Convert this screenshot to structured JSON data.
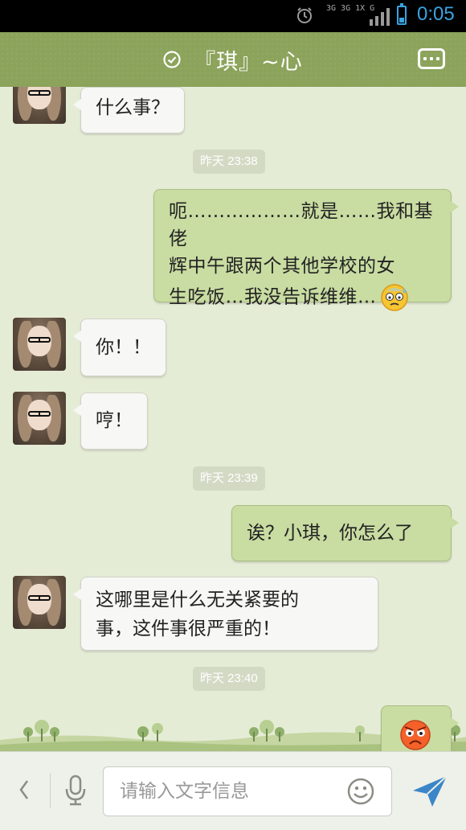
{
  "status_bar": {
    "time": "0:05",
    "network": "3G 3G 1X G",
    "icons": [
      "alarm-icon",
      "signal-icon",
      "battery-icon"
    ]
  },
  "header": {
    "title": "『琪』~心",
    "verified_icon": "check-circle-icon",
    "menu_icon": "more-icon"
  },
  "messages": [
    {
      "side": "in",
      "text": "什么事？"
    },
    {
      "type": "time",
      "text": "昨天 23:38"
    },
    {
      "side": "out",
      "lines": [
        "呃………………就是……我和基佬",
        "辉中午跟两个其他学校的女",
        "生吃饭…我没告诉维维…"
      ],
      "emoji": "sweat-emoji"
    },
    {
      "side": "in",
      "text": "你！！"
    },
    {
      "side": "in",
      "text": "哼！"
    },
    {
      "type": "time",
      "text": "昨天 23:39"
    },
    {
      "side": "out",
      "text": "诶？小琪，你怎么了"
    },
    {
      "side": "in",
      "lines": [
        "这哪里是什么无关紧要的",
        "事，这件事很严重的！"
      ]
    },
    {
      "type": "time",
      "text": "昨天 23:40"
    },
    {
      "side": "out",
      "emoji": "angry-emoji"
    }
  ],
  "input_bar": {
    "placeholder": "请输入文字信息",
    "icons": [
      "back-icon",
      "mic-icon",
      "smile-icon",
      "send-icon"
    ]
  },
  "colors": {
    "header": "#8ba35a",
    "background": "#e5ecd6",
    "bubble_out": "#c9dca2",
    "bubble_in": "#f7f7f5",
    "accent": "#3aa3e0"
  }
}
